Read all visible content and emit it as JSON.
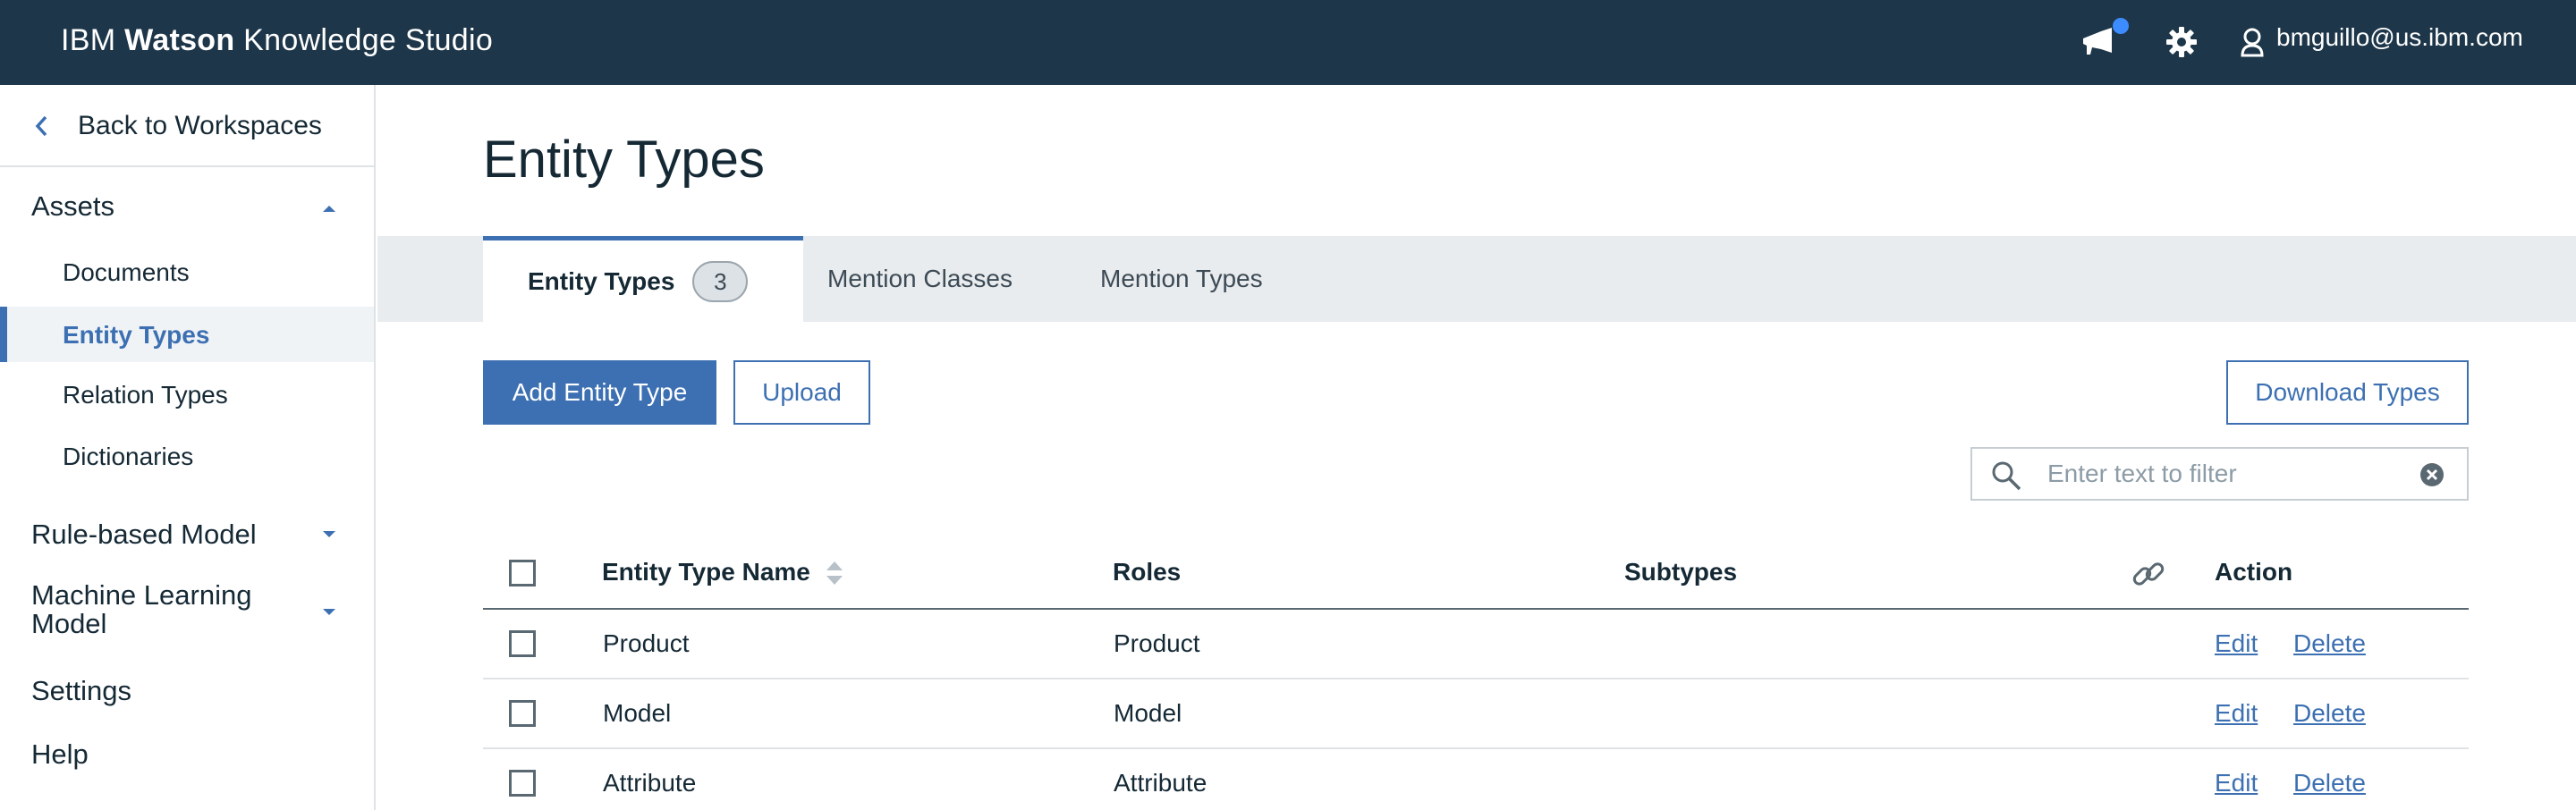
{
  "app": {
    "brand_prefix": "IBM",
    "brand_bold": "Watson",
    "brand_suffix": "Knowledge Studio",
    "user_email": "bmguillo@us.ibm.com"
  },
  "icons": {
    "announcement": "megaphone-icon",
    "settings": "gear-icon",
    "user": "user-icon",
    "back": "chevron-left-icon",
    "search": "search-icon",
    "clear": "clear-icon",
    "sort": "sort-icon",
    "link": "link-icon"
  },
  "colors": {
    "topbar": "#1d3649",
    "accent": "#3d70b2",
    "notification_dot": "#3d8cff"
  },
  "sidebar": {
    "back_label": "Back to Workspaces",
    "assets_label": "Assets",
    "asset_items": [
      {
        "label": "Documents"
      },
      {
        "label": "Entity Types"
      },
      {
        "label": "Relation Types"
      },
      {
        "label": "Dictionaries"
      }
    ],
    "rule_model_label": "Rule-based Model",
    "ml_model_label": "Machine Learning Model",
    "settings_label": "Settings",
    "help_label": "Help"
  },
  "main": {
    "title": "Entity Types",
    "tabs": [
      {
        "label": "Entity Types",
        "count": "3"
      },
      {
        "label": "Mention Classes"
      },
      {
        "label": "Mention Types"
      }
    ],
    "add_button": "Add Entity Type",
    "upload_button": "Upload",
    "download_button": "Download Types",
    "filter_placeholder": "Enter text to filter"
  },
  "table": {
    "headers": {
      "name": "Entity Type Name",
      "roles": "Roles",
      "subtypes": "Subtypes",
      "action": "Action"
    },
    "rows": [
      {
        "name": "Product",
        "roles": "Product",
        "subtypes": "",
        "edit": "Edit",
        "delete": "Delete"
      },
      {
        "name": "Model",
        "roles": "Model",
        "subtypes": "",
        "edit": "Edit",
        "delete": "Delete"
      },
      {
        "name": "Attribute",
        "roles": "Attribute",
        "subtypes": "",
        "edit": "Edit",
        "delete": "Delete"
      }
    ]
  }
}
